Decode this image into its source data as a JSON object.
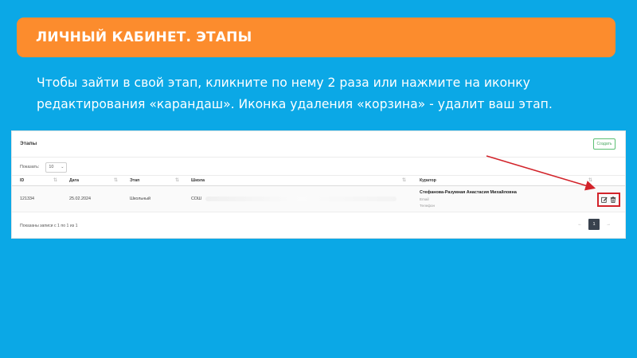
{
  "banner": {
    "title": "ЛИЧНЫЙ КАБИНЕТ. ЭТАПЫ"
  },
  "instructions": {
    "line1": "Чтобы зайти в свой этап, кликните по нему 2 раза или нажмите на иконку",
    "line2": "редактирования «карандаш». Иконка удаления «корзина» - удалит ваш этап."
  },
  "panel": {
    "title": "Этапы",
    "create_label": "Создать",
    "show_label": "Показать:",
    "page_size": "10"
  },
  "table": {
    "columns": [
      "ID",
      "Дата",
      "Этап",
      "Школа",
      "Куратор"
    ],
    "row": {
      "id": "121334",
      "date": "25.02.2024",
      "stage": "Школьный",
      "school": "СОШ",
      "curator_name": "Стефанова-Разумная Анастасия Михайловна",
      "curator_email_label": "Email",
      "curator_phone_label": "Телефон"
    }
  },
  "footer": {
    "info": "Показаны записи с 1 по 1 из 1"
  },
  "pager": {
    "prev": "←",
    "current": "1",
    "next": "→"
  },
  "colors": {
    "background": "#0ba8e6",
    "banner": "#fc8c2d",
    "highlight": "#d2232a"
  },
  "icons": {
    "edit": "pencil-icon",
    "delete": "trash-icon"
  }
}
